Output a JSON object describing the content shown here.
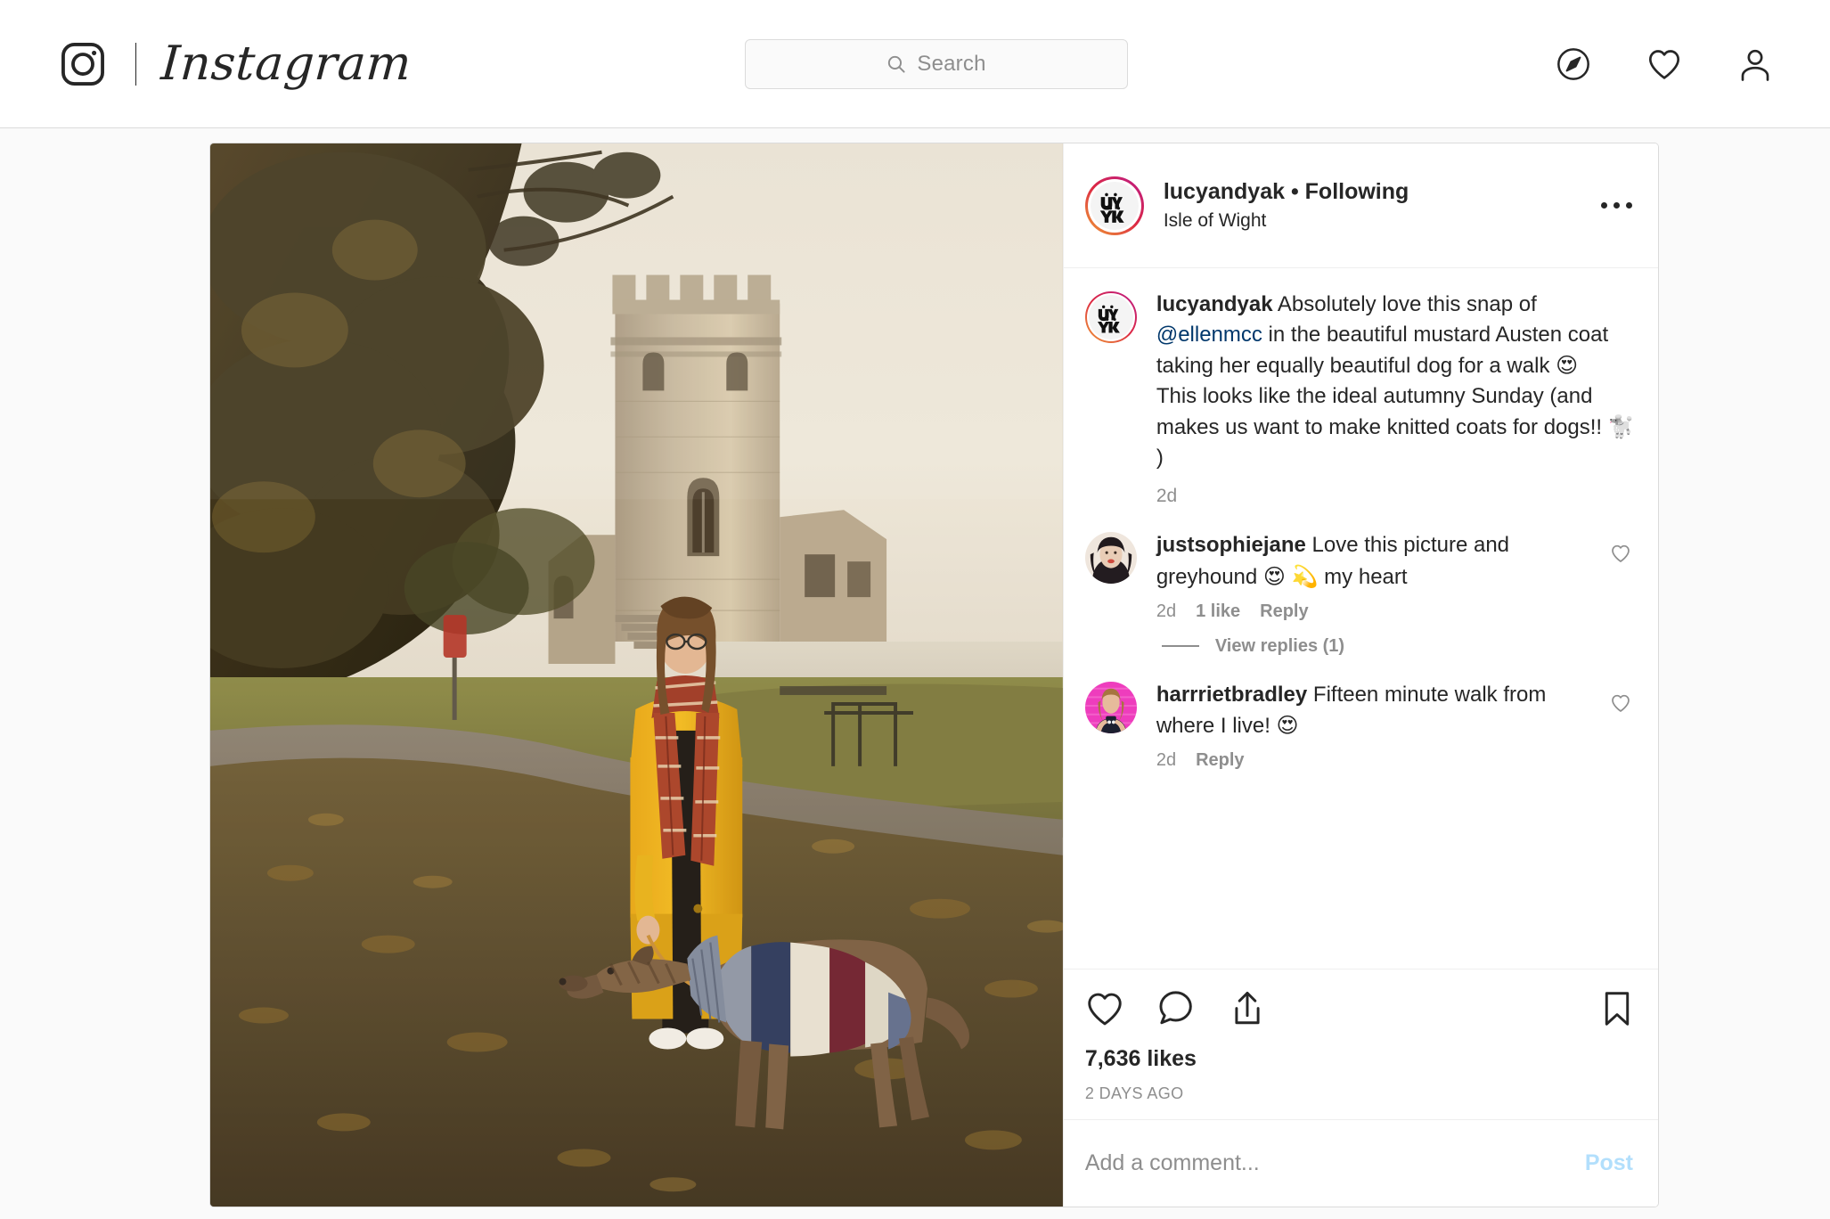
{
  "nav": {
    "brand": "Instagram",
    "logo_icon": "instagram-camera-icon",
    "search": {
      "placeholder": "Search",
      "value": "",
      "icon": "search-icon"
    },
    "icons": [
      {
        "name": "explore-compass-icon",
        "label": "Explore"
      },
      {
        "name": "activity-heart-icon",
        "label": "Activity"
      },
      {
        "name": "profile-person-icon",
        "label": "Profile"
      }
    ]
  },
  "post": {
    "author": {
      "username": "lucyandyak",
      "follow_state": "Following",
      "header_line": "lucyandyak • Following",
      "location": "Isle of Wight",
      "avatar_alt": "Lucy & Yak logo"
    },
    "more_options_label": "More options",
    "photo_alt": "Woman in mustard yellow coat and plaid scarf walking a greyhound wearing a striped knitted sweater, in front of Appley Tower",
    "caption": {
      "username": "lucyandyak",
      "text_part1": " Absolutely love this snap of ",
      "mention": "@ellenmcc",
      "text_part2": " in the beautiful mustard Austen coat taking her equally beautiful dog for a walk ",
      "emoji1": "😍",
      "text_part3": "This looks like the ideal autumny Sunday (and makes us want to make knitted coats for dogs!! ",
      "emoji2": "🐩",
      "text_part4": " )",
      "time": "2d"
    },
    "comments": [
      {
        "username": "justsophiejane",
        "text_part1": " Love this picture and greyhound ",
        "emoji1": "😍",
        "emoji2": "💫",
        "text_part2": " my heart",
        "time": "2d",
        "likes": "1 like",
        "reply_label": "Reply",
        "view_replies": "View replies (1)",
        "avatar_colors": [
          "#e8d9cf",
          "#2a2024",
          "#cf5a4a"
        ]
      },
      {
        "username": "harrrietbradley",
        "text_part1": " Fifteen minute walk from where I live! ",
        "emoji1": "😍",
        "text_part2": "",
        "time": "2d",
        "likes": "",
        "reply_label": "Reply",
        "view_replies": "",
        "avatar_colors": [
          "#ee3dbd",
          "#d9b596",
          "#1d2030"
        ]
      }
    ],
    "actions": {
      "like_icon": "heart-icon",
      "comment_icon": "speech-bubble-icon",
      "share_icon": "share-arrow-icon",
      "save_icon": "bookmark-icon",
      "likes_count": "7,636 likes",
      "posted_ago": "2 DAYS AGO"
    },
    "add_comment": {
      "placeholder": "Add a comment...",
      "value": "",
      "post_label": "Post"
    }
  },
  "colors": {
    "accent_link": "#00376b",
    "post_button": "#b2dffc",
    "text_primary": "#262626",
    "text_secondary": "#8e8e8e",
    "border": "#dbdbdb",
    "page_bg": "#fafafa"
  }
}
